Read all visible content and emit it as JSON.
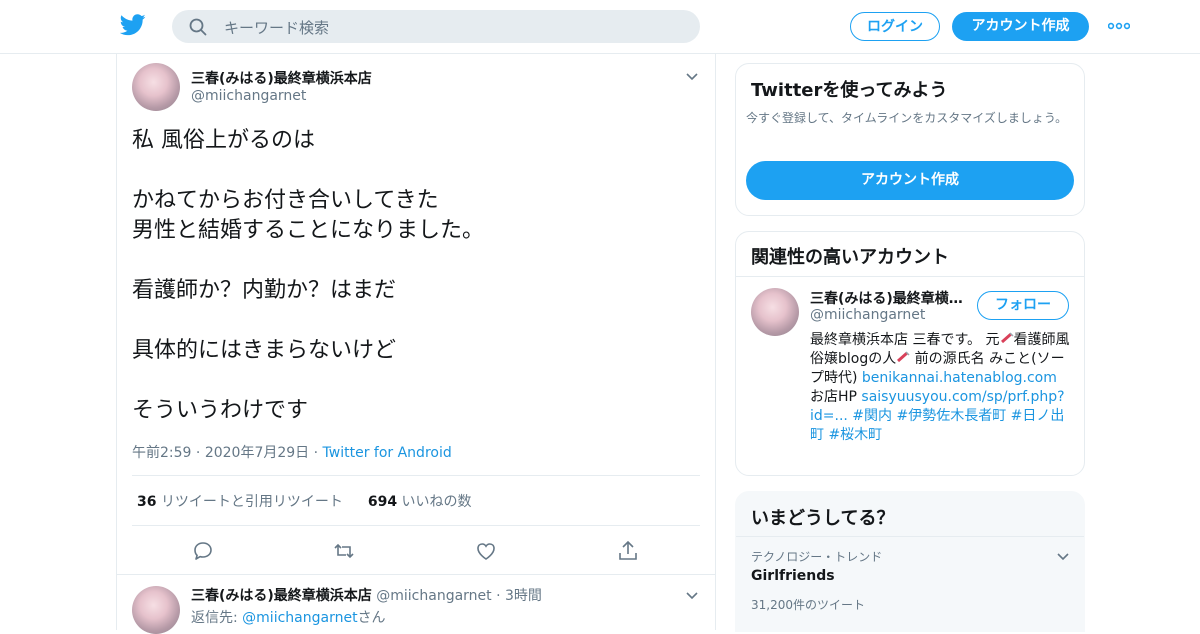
{
  "header": {
    "search_placeholder": "キーワード検索",
    "login_label": "ログイン",
    "signup_label": "アカウント作成"
  },
  "tweet": {
    "author_name": "三春(みはる)最終章横浜本店",
    "author_handle": "@miichangarnet",
    "lines": [
      "私 風俗上がるのは",
      "",
      "かねてからお付き合いしてきた",
      "男性と結婚することになりました。",
      "",
      "看護師か？内勤か？はまだ",
      "",
      "具体的にはきまらないけど",
      "",
      "そういうわけです"
    ],
    "time": "午前2:59",
    "date": "2020年7月29日",
    "source": "Twitter for Android",
    "retweet_count": "36",
    "retweet_label": "リツイートと引用リツイート",
    "like_count": "694",
    "like_label": "いいねの数"
  },
  "reply": {
    "author_name": "三春(みはる)最終章横浜本店",
    "author_handle": "@miichangarnet",
    "age": "3時間",
    "reply_to_prefix": "返信先: ",
    "reply_to_handle": "@miichangarnet",
    "reply_to_suffix": "さん"
  },
  "sidebar": {
    "signup_card": {
      "title": "Twitterを使ってみよう",
      "description": "今すぐ登録して、タイムラインをカスタマイズしましょう。",
      "button_label": "アカウント作成"
    },
    "related": {
      "title": "関連性の高いアカウント",
      "name": "三春(みはる)最終章横浜本店",
      "handle": "@miichangarnet",
      "follow_label": "フォロー",
      "bio_part1": "最終章横浜本店 三春です。 元",
      "bio_part2": "看護師風俗嬢blogの人",
      "bio_part3": " 前の源氏名 みこと(ソープ時代)",
      "link1": "benikannai.hatenablog.com",
      "bio_part4": " お店HP ",
      "link2": "saisyuusyou.com/sp/prf.php?id=...",
      "hashtags": " #関内 #伊勢佐木長者町 #日ノ出町 #桜木町"
    },
    "trends": {
      "title": "いまどうしてる？",
      "category": "テクノロジー・トレンド",
      "topic": "Girlfriends",
      "count": "31,200件のツイート"
    }
  }
}
